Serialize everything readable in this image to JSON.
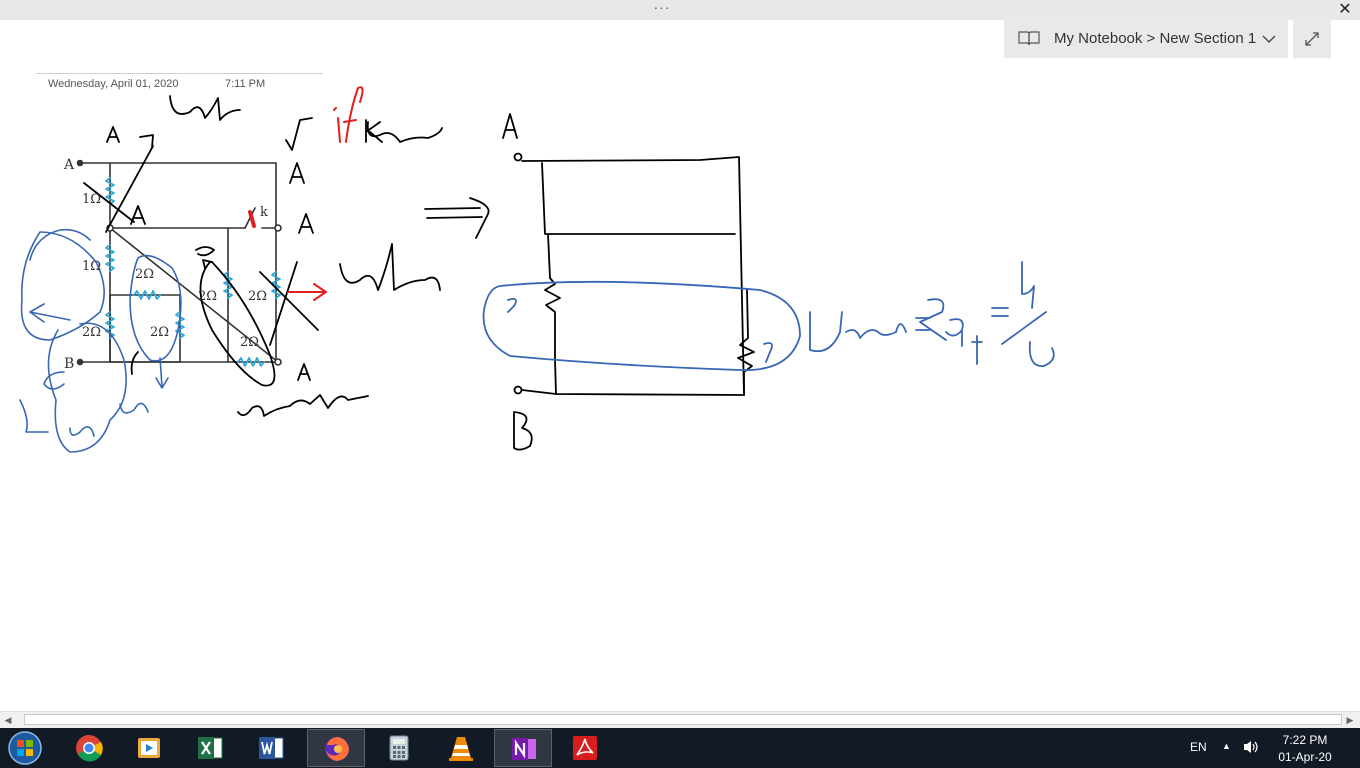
{
  "window": {
    "more_label": "···",
    "close_label": "✕"
  },
  "notebook": {
    "breadcrumb": "My Notebook > New Section 1",
    "dropdown_icon": "chevron-down-icon",
    "expand_icon": "expand-icon"
  },
  "page": {
    "date": "Wednesday, April 01, 2020",
    "time": "7:11 PM"
  },
  "drawing": {
    "node_labels": [
      "A",
      "B"
    ],
    "handwritten_labels": [
      "A",
      "A",
      "A",
      "A",
      "A",
      "A",
      "B",
      "if",
      "K"
    ],
    "resistor_labels": [
      "1Ω",
      "1Ω",
      "2Ω",
      "2Ω",
      "2Ω",
      "2Ω",
      "2Ω",
      "2Ω",
      "2Ω"
    ],
    "switch_label": "k",
    "note_shorted_top": "اتصال کوتاه",
    "note_shorted_right": "اتصال کوتاه",
    "note_closed": "بسته",
    "note_parallel_2r": "موازی = ۲ R",
    "note_parallel_right": "موازی",
    "formula_lhs": "Req",
    "formula_eq": "=",
    "formula_num": "4",
    "formula_den": "5",
    "resistor_value_a": "۲",
    "resistor_value_b": "۲",
    "label_2r": "۲R",
    "ink_colors": {
      "black": "#000000",
      "blue": "#3867b5",
      "red": "#e02020",
      "wire_blue": "#2aa7d8"
    }
  },
  "taskbar": {
    "apps": [
      {
        "name": "chrome",
        "active": false
      },
      {
        "name": "media-player",
        "active": false
      },
      {
        "name": "excel",
        "active": false
      },
      {
        "name": "word",
        "active": false
      },
      {
        "name": "firefox",
        "active": true
      },
      {
        "name": "calculator",
        "active": false
      },
      {
        "name": "vlc",
        "active": false
      },
      {
        "name": "onenote",
        "active": true
      },
      {
        "name": "acrobat",
        "active": false
      }
    ],
    "tray": {
      "lang": "EN",
      "time": "7:22 PM",
      "date": "01-Apr-20",
      "tray_arrow": "▲"
    }
  },
  "scrollbar": {
    "left_arrow": "◀",
    "right_arrow": "▶"
  }
}
